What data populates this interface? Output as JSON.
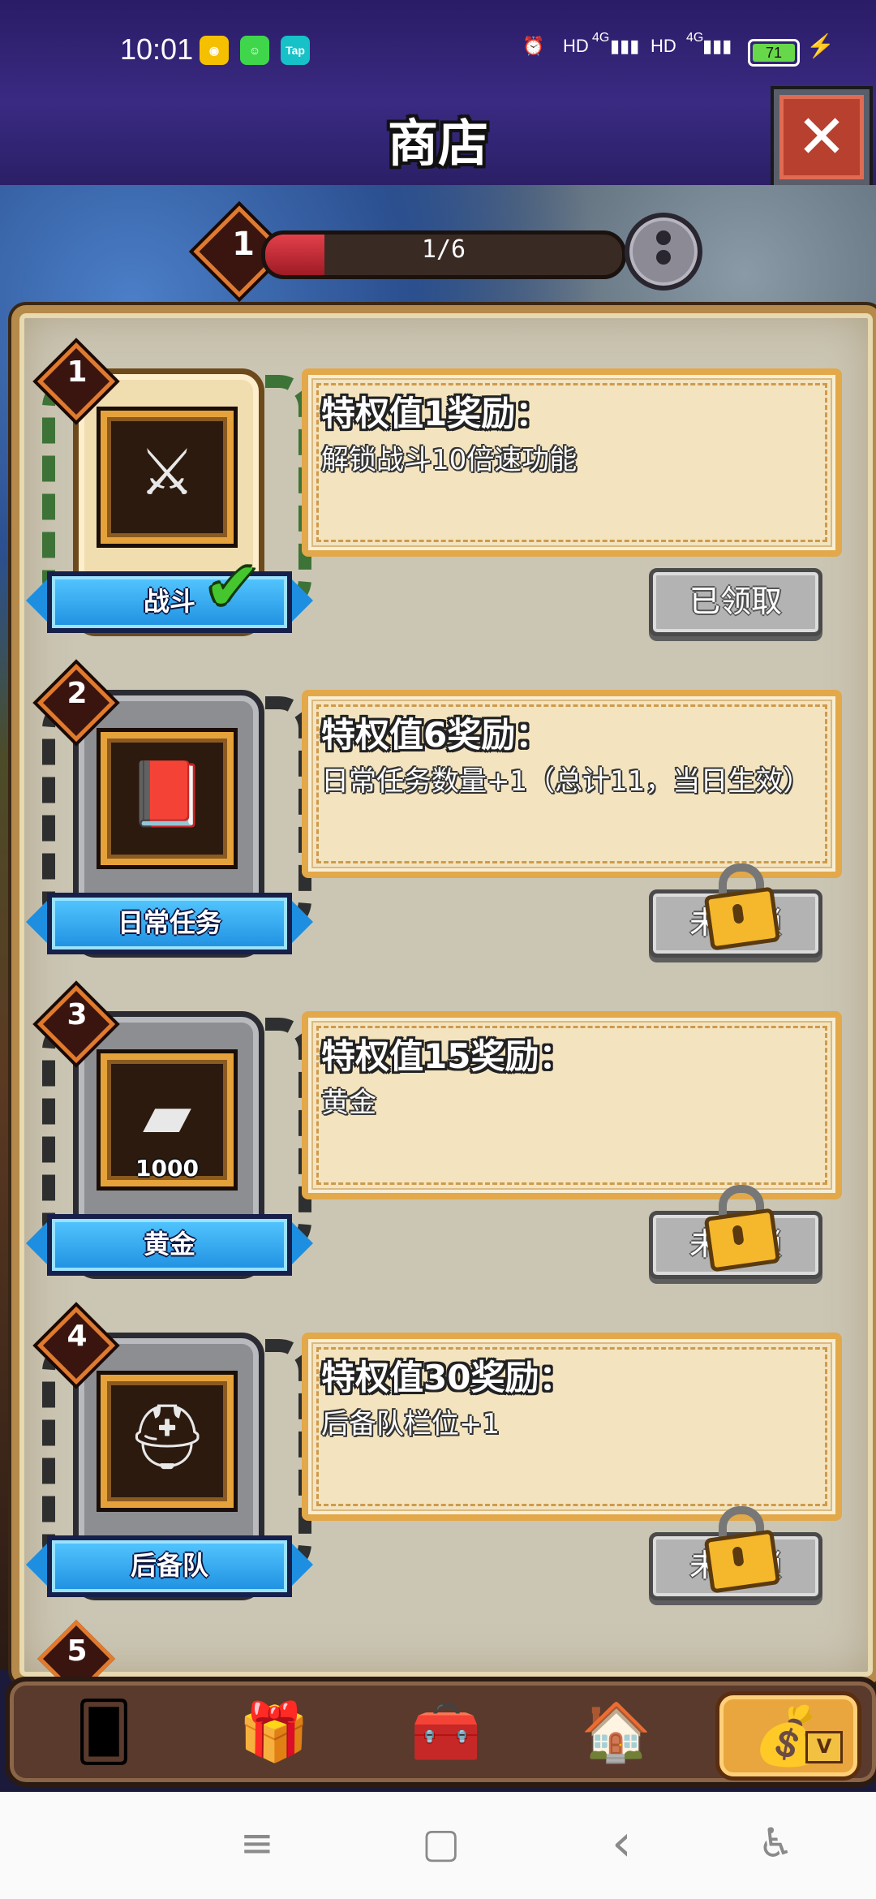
{
  "status_bar": {
    "time": "10:01",
    "app_icons": [
      {
        "name": "weibo-icon",
        "color": "#f5c000",
        "glyph": "◉"
      },
      {
        "name": "wechat-mini-icon",
        "color": "#3fd64c",
        "glyph": "☺"
      },
      {
        "name": "taptap-icon",
        "color": "#16c1c8",
        "glyph": "Tap"
      }
    ],
    "right_items": [
      "⏰",
      "HD",
      "4G",
      "▮▮▮",
      "HD",
      "4G",
      "▮▮▮"
    ],
    "battery": "71",
    "charging_glyph": "⚡"
  },
  "header": {
    "title": "商店",
    "close_glyph": "✕"
  },
  "progress": {
    "level": "1",
    "text": "1/6",
    "fill_fraction": 0.167
  },
  "rewards": [
    {
      "number": "1",
      "title": "特权值1奖励：",
      "text": "解锁战斗10倍速功能",
      "label": "战斗",
      "icon_glyph": "⚔",
      "state": "已领取",
      "claimed": true,
      "qty": ""
    },
    {
      "number": "2",
      "title": "特权值6奖励：",
      "text": "日常任务数量+1（总计11，当日生效）",
      "label": "日常任务",
      "icon_glyph": "📕",
      "state": "未解锁",
      "claimed": false,
      "qty": ""
    },
    {
      "number": "3",
      "title": "特权值15奖励：",
      "text": "黄金",
      "label": "黄金",
      "icon_glyph": "▰",
      "state": "未解锁",
      "claimed": false,
      "qty": "1000"
    },
    {
      "number": "4",
      "title": "特权值30奖励：",
      "text": "后备队栏位+1",
      "label": "后备队",
      "icon_glyph": "⛑",
      "state": "未解锁",
      "claimed": false,
      "qty": ""
    }
  ],
  "peek_number": "5",
  "tabs": [
    {
      "name": "card-tab",
      "glyph": "🂠"
    },
    {
      "name": "gift-tab",
      "glyph": "🎁"
    },
    {
      "name": "chest-tab",
      "glyph": "🧰"
    },
    {
      "name": "house-tab",
      "glyph": "🏠"
    },
    {
      "name": "vip-bag-tab",
      "glyph": "💰",
      "badge": "V",
      "active": true
    }
  ],
  "system_nav": {
    "menu": "≡",
    "home": "▢",
    "back": "‹",
    "accessibility": "♿"
  }
}
